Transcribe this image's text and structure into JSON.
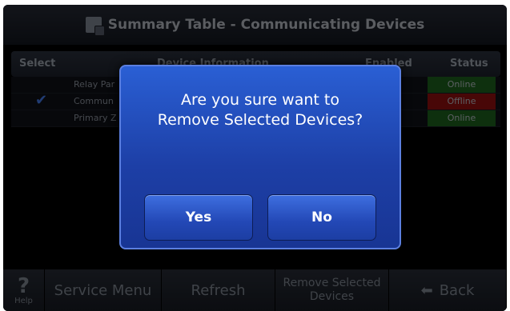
{
  "title": "Summary Table - Communicating Devices",
  "table": {
    "headers": {
      "select": "Select",
      "info": "Device Information",
      "enabled": "Enabled",
      "status": "Status"
    },
    "rows": [
      {
        "info": "Relay Par",
        "status": "Online",
        "checked": false
      },
      {
        "info": "Commun",
        "status": "Offline",
        "checked": true
      },
      {
        "info": "Primary Z",
        "status": "Online",
        "checked": false
      }
    ],
    "check_glyph": "✔"
  },
  "dialog": {
    "message_line1": "Are you sure want to",
    "message_line2": "Remove Selected Devices?",
    "yes_label": "Yes",
    "no_label": "No"
  },
  "toolbar": {
    "help_glyph": "?",
    "help_label": "Help",
    "service_menu": "Service Menu",
    "refresh": "Refresh",
    "remove_line1": "Remove Selected",
    "remove_line2": "Devices",
    "back_arrow": "⬅",
    "back": "Back"
  },
  "colors": {
    "dialog_blue": "#1d3fa6",
    "online_green": "#1f6b1f",
    "offline_red": "#a01010",
    "check_blue": "#4a86ff"
  },
  "icons": {
    "title": "device-table-icon",
    "help": "help-icon",
    "back": "back-arrow-icon",
    "check": "check-icon"
  }
}
